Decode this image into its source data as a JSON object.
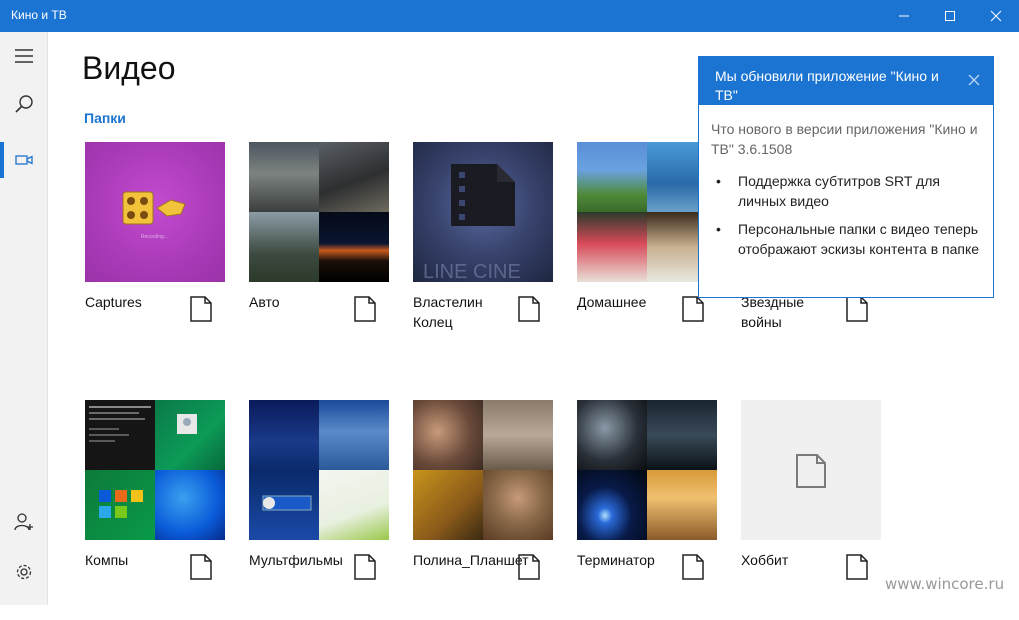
{
  "window": {
    "title": "Кино и ТВ",
    "accent_color": "#1b74d1",
    "controls": [
      "minimize-icon",
      "maximize-icon",
      "close-icon"
    ]
  },
  "sidebar": {
    "items": [
      {
        "icon": "hamburger-menu-icon",
        "active": false
      },
      {
        "icon": "search-icon",
        "active": false
      },
      {
        "icon": "video-camera-icon",
        "active": true
      },
      {
        "icon": "account-add-icon",
        "active": false
      },
      {
        "icon": "gear-icon",
        "active": false
      }
    ]
  },
  "main": {
    "page_title": "Видео",
    "section_label": "Папки",
    "folders": [
      {
        "name": "Captures",
        "icon": "folder-icon"
      },
      {
        "name": "Авто",
        "icon": "folder-icon"
      },
      {
        "name": "Властелин Колец",
        "icon": "folder-icon"
      },
      {
        "name": "Домашнее",
        "icon": "folder-icon"
      },
      {
        "name": "Звездные войны",
        "icon": "folder-icon"
      },
      {
        "name": "Компы",
        "icon": "folder-icon"
      },
      {
        "name": "Мультфильмы",
        "icon": "folder-icon"
      },
      {
        "name": "Полина_Планшет",
        "icon": "folder-icon"
      },
      {
        "name": "Терминатор",
        "icon": "folder-icon"
      },
      {
        "name": "Хоббит",
        "icon": "folder-icon"
      }
    ]
  },
  "toast": {
    "title": "Мы обновили приложение \"Кино и ТВ\"",
    "body": "Что нового в версии приложения \"Кино и ТВ\" 3.6.1508",
    "items": [
      "Поддержка субтитров SRT для личных видео",
      "Персональные папки с видео теперь отображают эскизы контента в папке"
    ],
    "close_icon": "close-icon"
  },
  "watermark": "www.wincore.ru"
}
